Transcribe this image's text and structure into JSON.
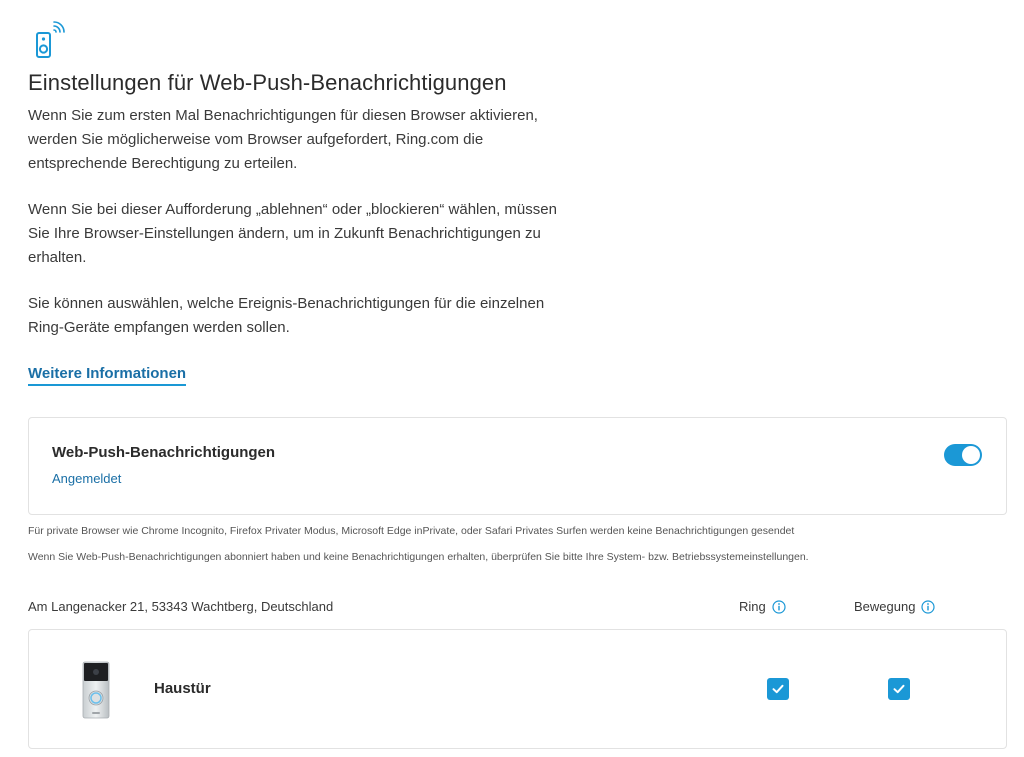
{
  "header": {
    "icon": "doorbell-wifi-icon",
    "title": "Einstellungen für Web-Push-Benachrichtigungen"
  },
  "intro": {
    "paragraph1": "Wenn Sie zum ersten Mal Benachrichtigungen für diesen Browser aktivieren, werden Sie möglicherweise vom Browser aufgefordert, Ring.com die entsprechende Berechtigung zu erteilen.",
    "paragraph2": "Wenn Sie bei dieser Aufforderung „ablehnen“ oder „blockieren“ wählen, müssen Sie Ihre Browser-Einstellungen ändern, um in Zukunft Benachrichtigungen zu erhalten.",
    "paragraph3": "Sie können auswählen, welche Ereignis-Benachrichtigungen für die einzelnen Ring-Geräte empfangen werden sollen.",
    "more_link": "Weitere Informationen"
  },
  "push": {
    "title": "Web-Push-Benachrichtigungen",
    "status": "Angemeldet",
    "enabled": true,
    "toggle_color": "#1b98d6"
  },
  "notes": {
    "private_browsers": "Für private Browser wie Chrome Incognito, Firefox Privater Modus, Microsoft Edge inPrivate, oder Safari Privates Surfen werden keine Benachrichtigungen gesendet",
    "troubleshoot": "Wenn Sie Web-Push-Benachrichtigungen abonniert haben und keine Benachrichtigungen erhalten, überprüfen Sie bitte Ihre System- bzw. Betriebssystemeinstellungen."
  },
  "location": {
    "address": "Am Langenacker 21, 53343 Wachtberg, Deutschland",
    "columns": {
      "ring": "Ring",
      "motion": "Bewegung"
    }
  },
  "devices": [
    {
      "name": "Haustür",
      "ring_enabled": true,
      "motion_enabled": true
    }
  ],
  "colors": {
    "accent": "#1b98d6",
    "link": "#1a6fa6"
  }
}
